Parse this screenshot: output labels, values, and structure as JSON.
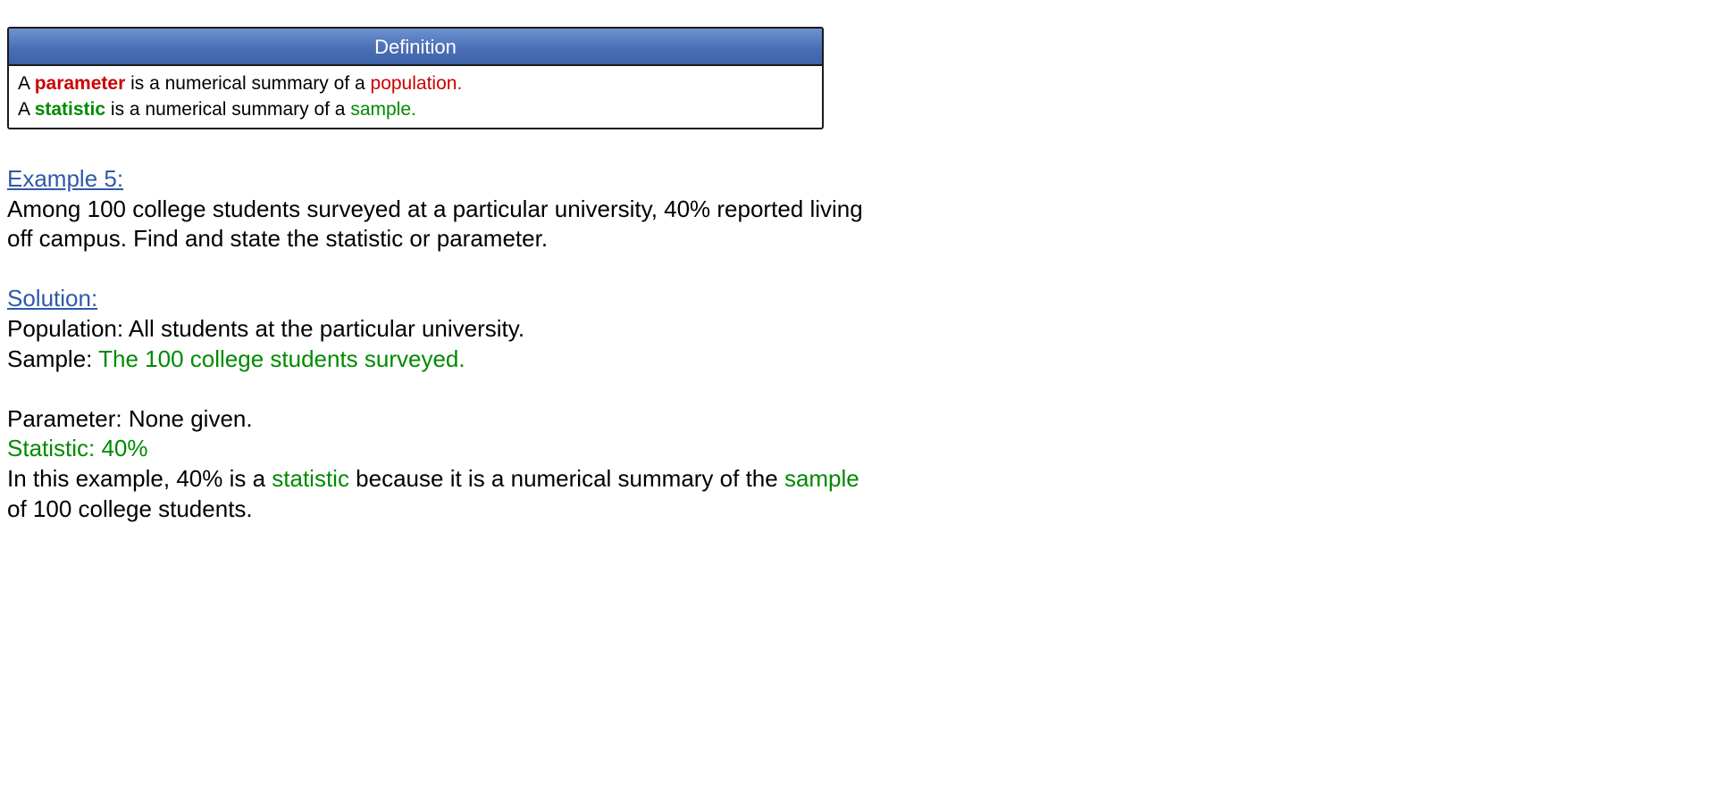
{
  "definition": {
    "header": "Definition",
    "line1": {
      "prefix": "A ",
      "term": "parameter",
      "middle": " is a numerical summary of a ",
      "object": "population",
      "end": "."
    },
    "line2": {
      "prefix": "A ",
      "term": "statistic",
      "middle": " is a numerical summary of a ",
      "object": "sample",
      "end": "."
    }
  },
  "example": {
    "heading": "Example 5:",
    "text_line1": "Among 100 college students surveyed at a particular university, 40% reported living",
    "text_line2": "off campus.  Find and state the statistic or parameter."
  },
  "solution": {
    "heading": "Solution:",
    "population_label": "Population:  ",
    "population_value": "All students at the particular university.",
    "sample_label": "Sample:  ",
    "sample_value": "The 100 college students surveyed.",
    "parameter_line": "Parameter:  None given.",
    "statistic_line": "Statistic:  40%",
    "explanation": {
      "part1": "In this example, 40% is a ",
      "term1": "statistic",
      "part2": " because it is a numerical summary of the ",
      "term2": "sample",
      "line2": "of 100 college students."
    }
  },
  "colors": {
    "term_red": "#cc0000",
    "term_green": "#008a00",
    "heading_link": "#2f5aa8",
    "header_blue": "#4a6fb6"
  }
}
